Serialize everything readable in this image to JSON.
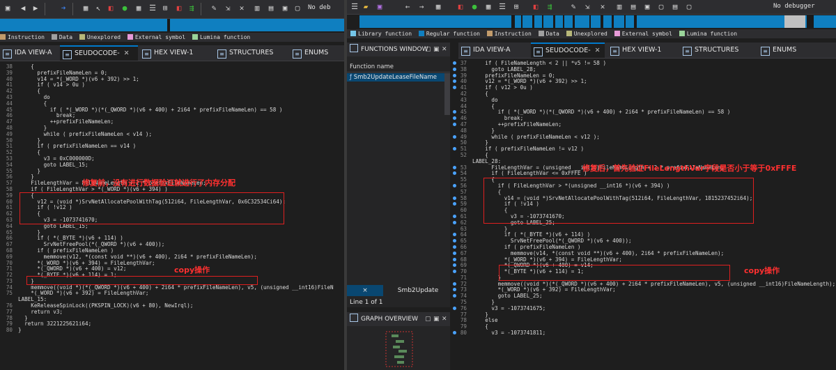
{
  "left": {
    "toolbar": {
      "debugger": "No deb"
    },
    "legend": [
      {
        "label": "Instruction",
        "color": "#c29b6b"
      },
      {
        "label": "Data",
        "color": "#a0a0a0"
      },
      {
        "label": "Unexplored",
        "color": "#b7b779"
      },
      {
        "label": "External symbol",
        "color": "#e79ad8"
      },
      {
        "label": "Lumina function",
        "color": "#9ad49a"
      }
    ],
    "tabs": [
      {
        "label": "IDA VIEW-A"
      },
      {
        "label": "SEUDOCODE-"
      },
      {
        "label": "HEX VIEW-1"
      },
      {
        "label": "STRUCTURES"
      },
      {
        "label": "ENUMS"
      }
    ],
    "code": [
      {
        "n": "38",
        "t": "    {"
      },
      {
        "n": "39",
        "t": "      prefixFileNameLen = 0;"
      },
      {
        "n": "40",
        "t": "      v14 = *(_WORD *)(v6 + 392) >> 1;"
      },
      {
        "n": "41",
        "t": "      if ( v14 > 0u )"
      },
      {
        "n": "42",
        "t": "      {"
      },
      {
        "n": "43",
        "t": "        do"
      },
      {
        "n": "44",
        "t": "        {"
      },
      {
        "n": "45",
        "t": "          if ( *(_WORD *)(*(_QWORD *)(v6 + 400) + 2i64 * prefixFileNameLen) == 58 )"
      },
      {
        "n": "46",
        "t": "            break;"
      },
      {
        "n": "47",
        "t": "          ++prefixFileNameLen;"
      },
      {
        "n": "48",
        "t": "        }"
      },
      {
        "n": "49",
        "t": "        while ( prefixFileNameLen < v14 );"
      },
      {
        "n": "50",
        "t": "      }"
      },
      {
        "n": "51",
        "t": "      if ( prefixFileNameLen == v14 )"
      },
      {
        "n": "52",
        "t": "      {"
      },
      {
        "n": "53",
        "t": "        v3 = 0xC000000D;"
      },
      {
        "n": "54",
        "t": "        goto LABEL_15;"
      },
      {
        "n": "55",
        "t": "      }"
      },
      {
        "n": "56",
        "t": "    }"
      },
      {
        "n": "57",
        "t": "    FileLengthVar = FileNameLength + 2 * prefixFileNameLen;"
      },
      {
        "n": "58",
        "t": "    if ( FileLengthVar > *(_WORD *)(v6 + 394) )"
      },
      {
        "n": "59",
        "t": "    {"
      },
      {
        "n": "60",
        "t": "      v12 = (void *)SrvNetAllocatePoolWithTag(512i64, FileLengthVar, 0x6C32534Ci64);"
      },
      {
        "n": "61",
        "t": "      if ( !v12 )"
      },
      {
        "n": "62",
        "t": "      {"
      },
      {
        "n": "63",
        "t": "        v3 = -1073741670;"
      },
      {
        "n": "64",
        "t": "        goto LABEL_15;"
      },
      {
        "n": "65",
        "t": "      }"
      },
      {
        "n": "66",
        "t": "      if ( *(_BYTE *)(v6 + 114) )"
      },
      {
        "n": "67",
        "t": "        SrvNetFreePool(*(_QWORD *)(v6 + 400));"
      },
      {
        "n": "68",
        "t": "      if ( prefixFileNameLen )"
      },
      {
        "n": "69",
        "t": "        memmove(v12, *(const void **)(v6 + 400), 2i64 * prefixFileNameLen);"
      },
      {
        "n": "70",
        "t": "      *(_WORD *)(v6 + 394) = FileLengthVar;"
      },
      {
        "n": "71",
        "t": "      *(_QWORD *)(v6 + 400) = v12;"
      },
      {
        "n": "72",
        "t": "      *(_BYTE *)(v6 + 114) = 1;"
      },
      {
        "n": "73",
        "t": "    }"
      },
      {
        "n": "74",
        "t": "    memmove((void *)(*(_QWORD *)(v6 + 400) + 2i64 * prefixFileNameLen), v5, (unsigned __int16)FileN"
      },
      {
        "n": "75",
        "t": "    *(_WORD *)(v6 + 392) = FileLengthVar;"
      },
      {
        "n": "",
        "t": "LABEL_15:"
      },
      {
        "n": "76",
        "t": "    KeReleaseSpinLock((PKSPIN_LOCK)(v6 + 80), NewIrql);"
      },
      {
        "n": "77",
        "t": "    return v3;"
      },
      {
        "n": "78",
        "t": "  }"
      },
      {
        "n": "79",
        "t": "  return 3221225621i64;"
      },
      {
        "n": "80",
        "t": "}"
      }
    ],
    "annotations": {
      "before": "修复前，没有进行数据验证就进行了内存分配",
      "copy": "copy操作"
    }
  },
  "right": {
    "toolbar": {
      "debugger": "No debugger"
    },
    "legend": [
      {
        "label": "Library function",
        "color": "#74c5e8"
      },
      {
        "label": "Regular function",
        "color": "#0f7fc0"
      },
      {
        "label": "Instruction",
        "color": "#c29b6b"
      },
      {
        "label": "Data",
        "color": "#a0a0a0"
      },
      {
        "label": "Unexplored",
        "color": "#b7b779"
      },
      {
        "label": "External symbol",
        "color": "#e79ad8"
      },
      {
        "label": "Lumina function",
        "color": "#9ad49a"
      }
    ],
    "functions_window": {
      "title": "FUNCTIONS WINDOW",
      "column": "Function name",
      "selected": "Smb2UpdateLeaseFileName",
      "tab_close": "×",
      "tab_label": "Smb2Update",
      "status": "Line 1 of 1"
    },
    "graph_overview": {
      "title": "GRAPH OVERVIEW"
    },
    "tabs": [
      {
        "label": "IDA VIEW-A"
      },
      {
        "label": "SEUDOCODE-"
      },
      {
        "label": "HEX VIEW-1"
      },
      {
        "label": "STRUCTURES"
      },
      {
        "label": "ENUMS"
      }
    ],
    "code": [
      {
        "n": "37",
        "d": true,
        "t": "    if ( FileNameLength < 2 || *v5 != 58 )"
      },
      {
        "n": "38",
        "d": true,
        "t": "      goto LABEL_28;"
      },
      {
        "n": "39",
        "d": true,
        "t": "    prefixFileNameLen = 0;"
      },
      {
        "n": "40",
        "d": true,
        "t": "    v12 = *(_WORD *)(v6 + 392) >> 1;"
      },
      {
        "n": "41",
        "d": true,
        "t": "    if ( v12 > 0u )"
      },
      {
        "n": "42",
        "d": false,
        "t": "    {"
      },
      {
        "n": "43",
        "d": false,
        "t": "      do"
      },
      {
        "n": "44",
        "d": false,
        "t": "      {"
      },
      {
        "n": "45",
        "d": true,
        "t": "        if ( *(_WORD *)(*(_QWORD *)(v6 + 400) + 2i64 * prefixFileNameLen) == 58 )"
      },
      {
        "n": "46",
        "d": true,
        "t": "          break;"
      },
      {
        "n": "47",
        "d": true,
        "t": "        ++prefixFileNameLen;"
      },
      {
        "n": "48",
        "d": false,
        "t": "      }"
      },
      {
        "n": "49",
        "d": true,
        "t": "      while ( prefixFileNameLen < v12 );"
      },
      {
        "n": "50",
        "d": false,
        "t": "    }"
      },
      {
        "n": "51",
        "d": true,
        "t": "    if ( prefixFileNameLen != v12 )"
      },
      {
        "n": "52",
        "d": false,
        "t": "    {"
      },
      {
        "n": "",
        "d": false,
        "t": "LABEL_28:"
      },
      {
        "n": "53",
        "d": true,
        "t": "      FileLengthVar = (unsigned __int16)FileNameLength + 2 * prefixFileNameLen;"
      },
      {
        "n": "54",
        "d": true,
        "t": "      if ( FileLengthVar <= 0xFFFE )"
      },
      {
        "n": "55",
        "d": false,
        "t": "      {"
      },
      {
        "n": "56",
        "d": true,
        "t": "        if ( FileLengthVar > *(unsigned __int16 *)(v6 + 394) )"
      },
      {
        "n": "57",
        "d": false,
        "t": "        {"
      },
      {
        "n": "58",
        "d": true,
        "t": "          v14 = (void *)SrvNetAllocatePoolWithTag(512i64, FileLengthVar, 1815237452i64);"
      },
      {
        "n": "59",
        "d": true,
        "t": "          if ( !v14 )"
      },
      {
        "n": "60",
        "d": false,
        "t": "          {"
      },
      {
        "n": "61",
        "d": true,
        "t": "            v3 = -1073741670;"
      },
      {
        "n": "62",
        "d": true,
        "t": "            goto LABEL_25;"
      },
      {
        "n": "63",
        "d": false,
        "t": "          }"
      },
      {
        "n": "64",
        "d": true,
        "t": "          if ( *(_BYTE *)(v6 + 114) )"
      },
      {
        "n": "65",
        "d": true,
        "t": "            SrvNetFreePool(*(_QWORD *)(v6 + 400));"
      },
      {
        "n": "66",
        "d": true,
        "t": "          if ( prefixFileNameLen )"
      },
      {
        "n": "67",
        "d": true,
        "t": "            memmove(v14, *(const void **)(v6 + 400), 2i64 * prefixFileNameLen);"
      },
      {
        "n": "68",
        "d": true,
        "t": "          *(_WORD *)(v6 + 394) = FileLengthVar;"
      },
      {
        "n": "69",
        "d": true,
        "t": "          *(_QWORD *)(v6 + 400) = v14;"
      },
      {
        "n": "70",
        "d": true,
        "t": "          *(_BYTE *)(v6 + 114) = 1;"
      },
      {
        "n": "71",
        "d": false,
        "t": "        }"
      },
      {
        "n": "72",
        "d": true,
        "t": "        memmove((void *)(*(_QWORD *)(v6 + 400) + 2i64 * prefixFileNameLen), v5, (unsigned __int16)FileNameLength);"
      },
      {
        "n": "73",
        "d": true,
        "t": "        *(_WORD *)(v6 + 392) = FileLengthVar;"
      },
      {
        "n": "74",
        "d": true,
        "t": "        goto LABEL_25;"
      },
      {
        "n": "75",
        "d": false,
        "t": "      }"
      },
      {
        "n": "76",
        "d": true,
        "t": "      v3 = -1073741675;"
      },
      {
        "n": "77",
        "d": false,
        "t": "    }"
      },
      {
        "n": "78",
        "d": false,
        "t": "    else"
      },
      {
        "n": "79",
        "d": false,
        "t": "    {"
      },
      {
        "n": "80",
        "d": true,
        "t": "      v3 = -1073741811;"
      }
    ],
    "annotations": {
      "after": "修复后，首先验证FileLengthVar字段是否小于等于0xFFFE",
      "copy": "copy操作"
    }
  }
}
